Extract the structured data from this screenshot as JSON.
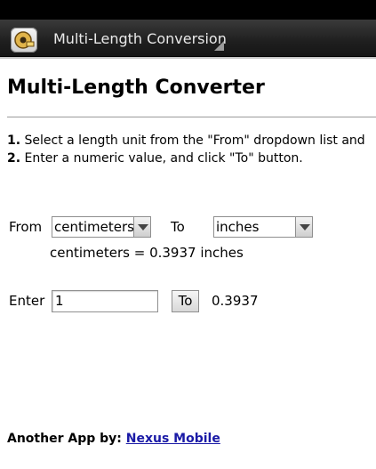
{
  "app": {
    "title": "Multi-Length Conversion",
    "icon": "tape-measure-icon"
  },
  "page": {
    "heading": "Multi-Length Converter",
    "step1_num": "1.",
    "step1_text": "Select a length unit from the \"From\" dropdown list and",
    "step2_num": "2.",
    "step2_text": "Enter a numeric value, and click \"To\" button."
  },
  "form": {
    "from_label": "From",
    "from_value": "centimeters",
    "to_label": "To",
    "to_value": "inches",
    "ratio_text": "centimeters = 0.3937 inches",
    "enter_label": "Enter",
    "input_value": "1",
    "to_button": "To",
    "result": "0.3937"
  },
  "footer": {
    "prefix": "Another App by:",
    "link": "Nexus Mobile",
    "link_color": "#1a1aa6"
  }
}
